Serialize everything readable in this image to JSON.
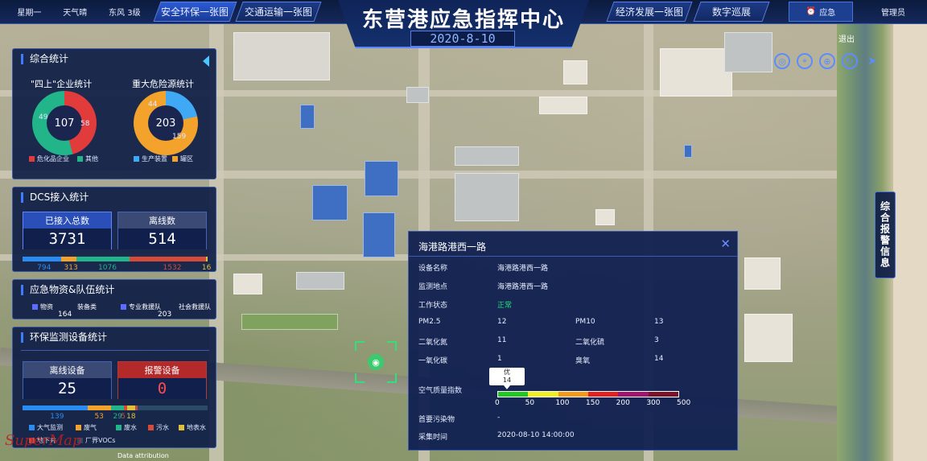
{
  "topbar": {
    "weather": {
      "day": "星期一",
      "weather": "天气晴",
      "wind": "东风 3级"
    },
    "left_tabs": [
      {
        "label": "安全环保一张图",
        "active": true
      },
      {
        "label": "交通运输一张图",
        "active": false
      }
    ],
    "right_tabs": [
      {
        "label": "经济发展一张图"
      },
      {
        "label": "数字巡展"
      }
    ],
    "title": "东营港应急指挥中心",
    "date": "2020-8-10",
    "alert": "应急",
    "user": "管理员",
    "logout": "退出"
  },
  "tools": [
    "target-icon",
    "locate-icon",
    "globe-icon",
    "refresh-icon",
    "send-icon"
  ],
  "overview": {
    "title": "综合统计",
    "ent": {
      "title": "\"四上\"企业统计",
      "total": "107",
      "a": "49",
      "b": "58",
      "leg_a": "危化品企业",
      "leg_b": "其他",
      "color_a": "#e23b3b",
      "color_b": "#22b58a"
    },
    "haz": {
      "title": "重大危险源统计",
      "total": "203",
      "a": "44",
      "b": "159",
      "leg_a": "生产装置",
      "leg_b": "罐区",
      "color_a": "#3fa9f5",
      "color_b": "#f3a32c"
    }
  },
  "dcs": {
    "title": "DCS接入统计",
    "connected_label": "已接入总数",
    "connected": "3731",
    "offline_label": "离线数",
    "offline": "514",
    "bar": [
      {
        "v": "794",
        "color": "#2a8cf0",
        "f": 0.21
      },
      {
        "v": "313",
        "color": "#f3a32c",
        "f": 0.08
      },
      {
        "v": "1076",
        "color": "#22b58a",
        "f": 0.29
      },
      {
        "v": "1532",
        "color": "#d64a3a",
        "f": 0.41
      },
      {
        "v": "16",
        "color": "#e0c03a",
        "f": 0.01
      }
    ]
  },
  "supplies": {
    "title": "应急物资&队伍统计",
    "items": [
      {
        "label": "物资",
        "num": "164"
      },
      {
        "label": "装备类",
        "num": ""
      },
      {
        "label": "专业救援队",
        "num": "203"
      },
      {
        "label": "社会救援队",
        "num": ""
      }
    ]
  },
  "env": {
    "title": "环保监测设备统计",
    "offline_label": "离线设备",
    "offline": "25",
    "alarm_label": "报警设备",
    "alarm": "0",
    "bar": [
      {
        "v": "139",
        "color": "#2a8cf0",
        "f": 0.35
      },
      {
        "v": "53",
        "color": "#f3a32c",
        "f": 0.13
      },
      {
        "v": "29",
        "color": "#22b58a",
        "f": 0.07
      },
      {
        "v": "5",
        "color": "#d64a3a",
        "f": 0.015
      },
      {
        "v": "18",
        "color": "#e0c03a",
        "f": 0.045
      },
      {
        "v": "",
        "color": "#c24a4a",
        "f": 0.01
      },
      {
        "v": "",
        "color": "#2b4968",
        "f": 0.38
      }
    ],
    "legend": [
      {
        "label": "大气监测",
        "color": "#2a8cf0"
      },
      {
        "label": "废气",
        "color": "#f3a32c"
      },
      {
        "label": "废水",
        "color": "#22b58a"
      },
      {
        "label": "污水",
        "color": "#d64a3a"
      },
      {
        "label": "地表水",
        "color": "#e0c03a"
      },
      {
        "label": "地下井",
        "color": "#c24a4a"
      },
      {
        "label": "厂界VOCs",
        "color": "#2b4968"
      }
    ]
  },
  "side_button": "综合报警信息",
  "popup": {
    "title": "海港路港西一路",
    "rows": [
      {
        "k": "设备名称",
        "v": "海港路港西一路"
      },
      {
        "k": "监测地点",
        "v": "海港路港西一路"
      },
      {
        "k": "工作状态",
        "v": "正常"
      }
    ],
    "pairs": [
      {
        "k1": "PM2.5",
        "v1": "12",
        "k2": "PM10",
        "v2": "13"
      },
      {
        "k1": "二氧化氮",
        "v1": "11",
        "k2": "二氧化硫",
        "v2": "3"
      },
      {
        "k1": "一氧化碳",
        "v1": "1",
        "k2": "臭氧",
        "v2": "14"
      }
    ],
    "aqi_label": "空气质量指数",
    "aqi_bubble_text": "优",
    "aqi_bubble_value": "14",
    "aqi_ticks": [
      "0",
      "50",
      "100",
      "150",
      "200",
      "300",
      "500"
    ],
    "aqi_colors": [
      "#22c822",
      "#f0f020",
      "#f39a1a",
      "#e52020",
      "#a3146e",
      "#7a1229"
    ],
    "pollutant_label": "首要污染物",
    "pollutant": "-",
    "time_label": "采集时间",
    "time": "2020-08-10 14:00:00"
  },
  "attribution": "Data attribution",
  "logo_text": "SuperMap"
}
